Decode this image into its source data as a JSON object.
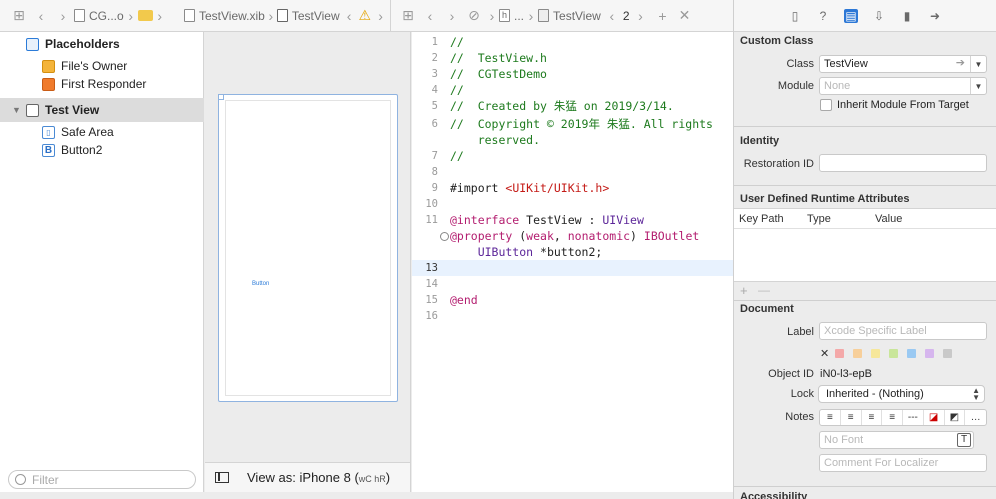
{
  "breadcrumb": {
    "project": "CG...o",
    "file": "TestView.xib",
    "scene": "TestView"
  },
  "assistant_bar": {
    "item": "...",
    "file": "TestView",
    "counter": "2"
  },
  "outline": {
    "section_label": "Placeholders",
    "placeholders": [
      "File's Owner",
      "First Responder"
    ],
    "view_label": "Test View",
    "children": [
      "Safe Area",
      "Button2"
    ],
    "filter_placeholder": "Filter"
  },
  "canvas": {
    "button_title": "Button",
    "view_as": "View as: iPhone 8 (",
    "size_class": "wC hR",
    "view_as_end": ")"
  },
  "code": {
    "lines": [
      {
        "n": "1",
        "t": "//"
      },
      {
        "n": "2",
        "t": "//  TestView.h"
      },
      {
        "n": "3",
        "t": "//  CGTestDemo"
      },
      {
        "n": "4",
        "t": "//"
      },
      {
        "n": "5",
        "t": "//  Created by 朱猛 on 2019/3/14."
      },
      {
        "n": "6",
        "t": "//  Copyright © 2019年 朱猛. All rights"
      },
      {
        "n": "",
        "t": "    reserved."
      },
      {
        "n": "7",
        "t": "//"
      },
      {
        "n": "8",
        "t": ""
      },
      {
        "n": "9",
        "t_kw": "#import ",
        "t_str": "<UIKit/UIKit.h>"
      },
      {
        "n": "10",
        "t": ""
      },
      {
        "n": "11",
        "t_kw": "@interface",
        "t_plain": " TestView : ",
        "t_typ": "UIView"
      },
      {
        "n": "",
        "t_kw": "@property",
        "t_plain": " (",
        "t_kw2": "weak",
        "t_plain2": ", ",
        "t_kw3": "nonatomic",
        "t_plain3": ") ",
        "t_kw4": "IBOutlet"
      },
      {
        "n": "",
        "t_typ": "    UIButton",
        "t_plain": " *button2;"
      },
      {
        "n": "13",
        "t": ""
      },
      {
        "n": "14",
        "t": ""
      },
      {
        "n": "15",
        "t_kw": "@end"
      },
      {
        "n": "16",
        "t": ""
      }
    ]
  },
  "inspector": {
    "custom_class": {
      "title": "Custom Class",
      "class_label": "Class",
      "class_value": "TestView",
      "module_label": "Module",
      "module_placeholder": "None",
      "inherit_label": "Inherit Module From Target"
    },
    "identity": {
      "title": "Identity",
      "restoration_label": "Restoration ID"
    },
    "udra": {
      "title": "User Defined Runtime Attributes",
      "columns": [
        "Key Path",
        "Type",
        "Value"
      ],
      "add": "+",
      "remove": "—"
    },
    "document": {
      "title": "Document",
      "label_label": "Label",
      "label_placeholder": "Xcode Specific Label",
      "clear": "✕",
      "object_id_label": "Object ID",
      "object_id_value": "iN0-l3-epB",
      "lock_label": "Lock",
      "lock_value": "Inherited - (Nothing)",
      "notes_label": "Notes",
      "font_placeholder": "No Font",
      "comment_placeholder": "Comment For Localizer",
      "swatch_colors": [
        "#f4a9a9",
        "#f7cf9a",
        "#f6e79a",
        "#c9e69a",
        "#9ac9f2",
        "#d6b6ee",
        "#c9c9c9"
      ]
    },
    "accessibility": {
      "title": "Accessibility"
    }
  }
}
